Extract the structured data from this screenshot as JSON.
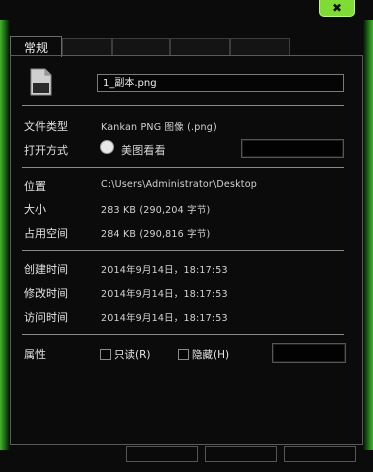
{
  "tabs": [
    {
      "label": "常规",
      "active": true
    },
    {
      "label": "",
      "active": false
    },
    {
      "label": "",
      "active": false
    },
    {
      "label": "",
      "active": false
    },
    {
      "label": "",
      "active": false
    }
  ],
  "file": {
    "name": "1_副本.png",
    "type_label": "文件类型",
    "type_value": "Kankan PNG 图像 (.png)",
    "opens_with_label": "打开方式",
    "opens_with_value": "美图看看",
    "location_label": "位置",
    "location_value": "C:\\Users\\Administrator\\Desktop",
    "size_label": "大小",
    "size_value": "283 KB (290,204 字节)",
    "disk_size_label": "占用空间",
    "disk_size_value": "284 KB (290,816 字节)",
    "created_label": "创建时间",
    "created_value": "2014年9月14日，18:17:53",
    "modified_label": "修改时间",
    "modified_value": "2014年9月14日，18:17:53",
    "accessed_label": "访问时间",
    "accessed_value": "2014年9月14日，18:17:53"
  },
  "attributes": {
    "label": "属性",
    "readonly_label": "只读(R)",
    "hidden_label": "隐藏(H)"
  },
  "colors": {
    "accent_green": "#6ee62e",
    "background": "#0b0b0b"
  },
  "icons": {
    "close": "close-icon",
    "file": "png-file-icon",
    "app": "meitu-viewer-icon"
  }
}
